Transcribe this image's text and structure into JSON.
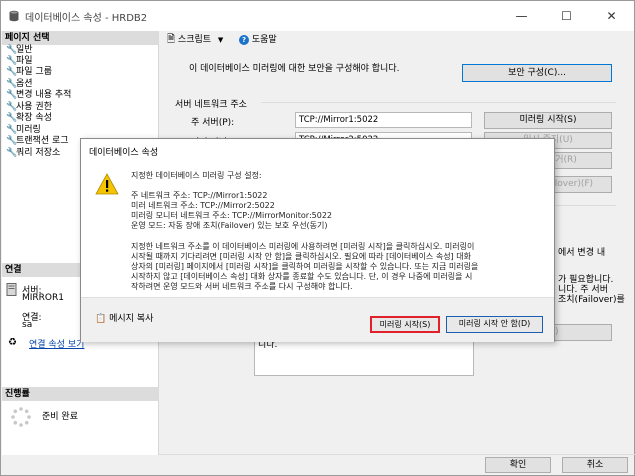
{
  "window": {
    "title": "데이터베이스 속성 - HRDB2",
    "min_label": "—",
    "max_label": "☐",
    "close_label": "✕"
  },
  "left": {
    "page_select_header": "페이지 선택",
    "items": [
      {
        "label": "일반"
      },
      {
        "label": "파일"
      },
      {
        "label": "파일 그룹"
      },
      {
        "label": "옵션"
      },
      {
        "label": "변경 내용 추적"
      },
      {
        "label": "사용 권한"
      },
      {
        "label": "확장 속성"
      },
      {
        "label": "미러링"
      },
      {
        "label": "트랜잭션 로그"
      },
      {
        "label": "쿼리 저장소"
      }
    ],
    "connection_header": "연결",
    "server_label": "서버:",
    "server_value": "MIRROR1",
    "conn_label": "연결:",
    "conn_value": "sa",
    "view_conn_props": "연결 속성 보기",
    "progress_header": "진행률",
    "progress_status": "준비 완료"
  },
  "toolbar": {
    "script_label": "스크립트",
    "help_label": "도움말"
  },
  "main": {
    "security_text": "이 데이터베이스 미러링에 대한 보안을 구성해야 합니다.",
    "configure_security_button": "보안 구성(C)...",
    "server_network_address": "서버 네트워크 주소",
    "principal_label": "주 서버(P):",
    "principal_value": "TCP://Mirror1:5022",
    "mirror_label": "미러 서버(M):",
    "mirror_value": "TCP://Mirror2:5022",
    "start_mirroring_button": "미러링 시작(S)",
    "pause_button": "일시 중지(U)",
    "remove_button": "미러링 제거(R)",
    "failover_button": "장애 조치(Failover)(F)",
    "partial_text_1": "에서 변경 내",
    "partial_text_2": "가 필요합니다.",
    "partial_text_3": "니다. 주 서버",
    "partial_text_4": "조치(Failover)를",
    "partial_button": "침(E)",
    "partial_box_text": "니다."
  },
  "dialog": {
    "title": "데이터베이스 속성",
    "heading": "지정한 데이터베이스 미러링 구성 설정:",
    "line1": "주 네트워크 주소: TCP://Mirror1:5022",
    "line2": "미러 네트워크 주소: TCP://Mirror2:5022",
    "line3": "미러링 모니터 네트워크 주소: TCP://MirrorMonitor:5022",
    "line4": "운영 모드: 자동 장애 조치(Failover) 있는 보호 우선(동기)",
    "para1": "지정한 네트워크 주소를 이 데이터베이스 미러링에 사용하려면 [미러링 시작]을 클릭하십시오. 미러링이",
    "para2": "시작될 때까지 기다리려면 [미러링 시작 안 함]을 클릭하십시오. 필요에 따라 [데이터베이스 속성] 대화",
    "para3": "상자의 [미러링] 페이지에서 [미러링 시작]을 클릭하여 미러링을 시작할 수 있습니다. 또는 지금 미러링을",
    "para4": "시작하지 않고 [데이터베이스 속성] 대화 상자를 종료할 수도 있습니다. 단, 이 경우 나중에 미러링을 시",
    "para5": "작하려면 운영 모드와 서버 네트워크 주소를 다시 구성해야 합니다.",
    "copy_message": "메시지 복사",
    "start_button": "미러링 시작(S)",
    "dont_start_button": "미러링 시작 안 함(D)",
    "start_button_border": "#e0202a",
    "dont_start_border": "#1a5fb4"
  },
  "footer": {
    "ok_button": "확인",
    "cancel_button": "취소"
  }
}
